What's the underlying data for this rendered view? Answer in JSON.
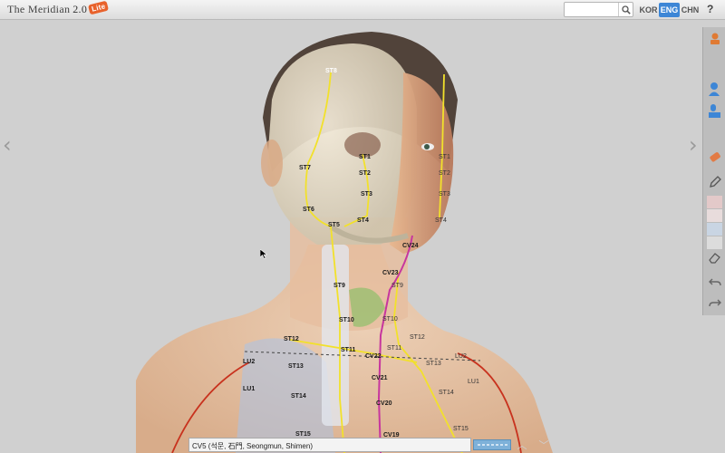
{
  "app": {
    "logo_text": "The Meridian",
    "version": "2.0",
    "edition_badge": "Lite"
  },
  "search": {
    "placeholder": "",
    "value": ""
  },
  "languages": [
    "KOR",
    "ENG",
    "CHN"
  ],
  "active_language": "ENG",
  "help_label": "?",
  "nav": {
    "left": "‹",
    "right": "›"
  },
  "toolbar": {
    "icons": [
      "stamp-icon",
      "head-side-icon",
      "head-front-icon",
      "eraser-icon",
      "pencil-icon",
      "color-swatches",
      "rubber-icon",
      "undo-icon",
      "redo-icon"
    ],
    "swatch_colors": [
      "#e3c9c9",
      "#cfd6e6",
      "#c9d5e3",
      "#d8d8d8"
    ]
  },
  "points": {
    "st8": "ST8",
    "st7": "ST7",
    "st6": "ST6",
    "st5": "ST5",
    "st1": "ST1",
    "st2": "ST2",
    "st3": "ST3",
    "st4": "ST4",
    "st1r": "ST1",
    "st2r": "ST2",
    "st3r": "ST3",
    "st4r": "ST4",
    "st9": "ST9",
    "st9r": "ST9",
    "st10": "ST10",
    "st10r": "ST10",
    "st11": "ST11",
    "st11r": "ST11",
    "st12": "ST12",
    "st12r": "ST12",
    "st13": "ST13",
    "st13r": "ST13",
    "st14": "ST14",
    "st14r": "ST14",
    "st15": "ST15",
    "st15r": "ST15",
    "lu1": "LU1",
    "lu2": "LU2",
    "lu1r": "LU1",
    "lu2r": "LU2",
    "cv24": "CV24",
    "cv23": "CV23",
    "cv22": "CV22",
    "cv21": "CV21",
    "cv20": "CV20",
    "cv19": "CV19"
  },
  "bottom": {
    "current_point": "CV5 (석문, 石門, Seongmun, Shimen)",
    "up": "︿",
    "down": "﹀"
  },
  "colors": {
    "meridian_stomach": "#f2e12b",
    "meridian_lung": "#c8321e",
    "meridian_conception": "#c7369e",
    "accent": "#3d86d6"
  }
}
